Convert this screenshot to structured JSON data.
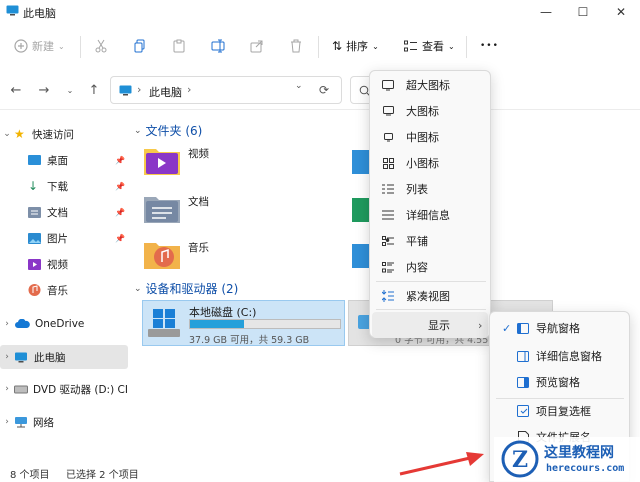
{
  "window": {
    "title": "此电脑",
    "min": "—",
    "max": "☐",
    "close": "✕"
  },
  "toolbar": {
    "new_label": "新建",
    "sort_label": "排序",
    "view_label": "查看",
    "more_label": "•••"
  },
  "address": {
    "arrow": "›",
    "path": "此电脑",
    "path_arrow": "›",
    "dropdown": "⌄",
    "refresh": "⟳"
  },
  "sidebar": {
    "quick_access": "快速访问",
    "items": [
      {
        "label": "桌面"
      },
      {
        "label": "下载"
      },
      {
        "label": "文档"
      },
      {
        "label": "图片"
      },
      {
        "label": "视频"
      },
      {
        "label": "音乐"
      }
    ],
    "onedrive": "OneDrive",
    "thispc": "此电脑",
    "dvd": "DVD 驱动器 (D:) CI",
    "network": "网络"
  },
  "content": {
    "folders_header": "文件夹 (6)",
    "folders": [
      {
        "label": "视频"
      },
      {
        "label": "文档"
      },
      {
        "label": "音乐"
      }
    ],
    "drives_header": "设备和驱动器 (2)",
    "drive": {
      "label": "本地磁盘 (C:)",
      "info": "37.9 GB 可用，共 59.3 GB",
      "used_fraction": 0.36
    },
    "drive2_info": "0 字节 可用，共 4.55"
  },
  "view_menu": {
    "items": [
      {
        "label": "超大图标"
      },
      {
        "label": "大图标"
      },
      {
        "label": "中图标"
      },
      {
        "label": "小图标"
      },
      {
        "label": "列表"
      },
      {
        "label": "详细信息"
      },
      {
        "label": "平铺"
      },
      {
        "label": "内容"
      },
      {
        "label": "紧凑视图"
      },
      {
        "label": "显示"
      }
    ],
    "selected_dot": "•",
    "submenu_arrow": "›"
  },
  "show_submenu": {
    "items": [
      {
        "label": "导航窗格"
      },
      {
        "label": "详细信息窗格"
      },
      {
        "label": "预览窗格"
      },
      {
        "label": "项目复选框"
      },
      {
        "label": "文件扩展名"
      }
    ],
    "check": "✓"
  },
  "status": {
    "count": "8 个项目",
    "selected": "已选择 2 个项目"
  },
  "watermark": {
    "brand": "这里教程网",
    "url": "herecours.com",
    "letter": "Z"
  }
}
